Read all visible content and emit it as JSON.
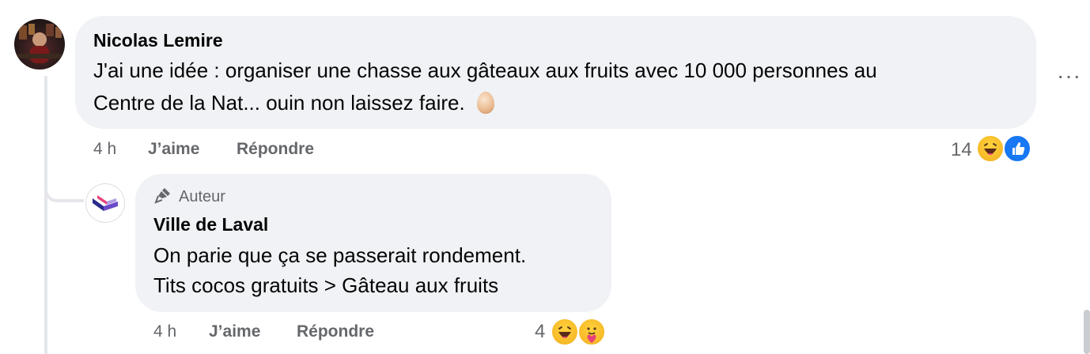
{
  "comment": {
    "author": "Nicolas Lemire",
    "text_line1": "J'ai une idée : organiser une chasse aux gâteaux aux fruits avec 10 000 personnes au",
    "text_line2": "Centre de la Nat... ouin non laissez faire.",
    "emoji": "🥚",
    "time": "4 h",
    "like_label": "J’aime",
    "reply_label": "Répondre",
    "reaction_count": "14",
    "reactions": [
      "laugh-reaction-icon",
      "like-reaction-icon"
    ],
    "more_label": "···"
  },
  "reply": {
    "badge_label": "Auteur",
    "author": "Ville de Laval",
    "text_line1": "On parie que ça se passerait rondement.",
    "text_line2": "Tits cocos gratuits > Gâteau aux fruits",
    "time": "4 h",
    "like_label": "J’aime",
    "reply_label": "Répondre",
    "reaction_count": "4",
    "reactions": [
      "laugh-reaction-icon",
      "care-reaction-icon"
    ]
  },
  "colors": {
    "bubble": "#f0f2f5",
    "meta_text": "#65676b",
    "like_blue": "#1877f2",
    "laval_purple": "#6b4bc9",
    "laval_pink": "#e8407a"
  }
}
